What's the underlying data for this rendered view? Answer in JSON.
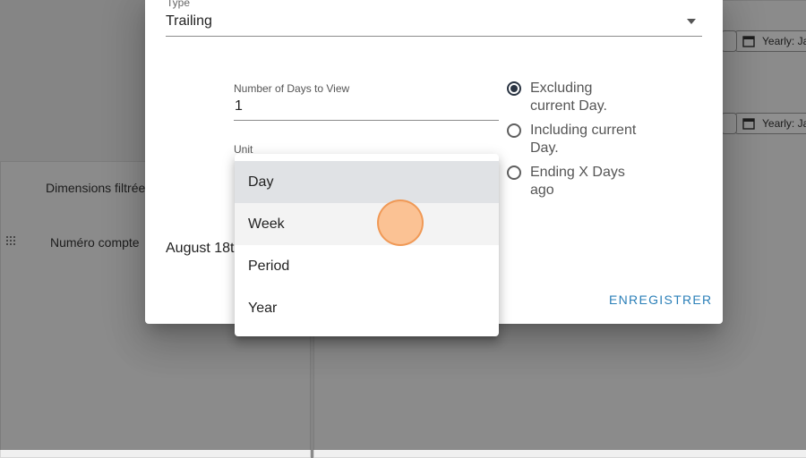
{
  "background": {
    "dimensions_label": "Dimensions filtrée",
    "account_label": "Numéro compte",
    "chip_1": "Yearly: Ja",
    "chip_2": "Yearly: Ja"
  },
  "dialog": {
    "type_label": "Type",
    "type_value": "Trailing",
    "days_label": "Number of Days to View",
    "days_value": "1",
    "unit_label": "Unit",
    "date_text": "August 18t",
    "radios": [
      {
        "label": "Excluding current Day.",
        "checked": true
      },
      {
        "label": "Including current Day.",
        "checked": false
      },
      {
        "label": "Ending X Days ago",
        "checked": false
      }
    ],
    "save_label": "ENREGISTRER"
  },
  "dropdown": {
    "options": [
      "Day",
      "Week",
      "Period",
      "Year"
    ],
    "selected": "Day",
    "hovered": "Week"
  },
  "colors": {
    "accent": "#2a7fb8",
    "radio_checked": "#2a3442",
    "selected_bg": "#e0e2e5"
  }
}
